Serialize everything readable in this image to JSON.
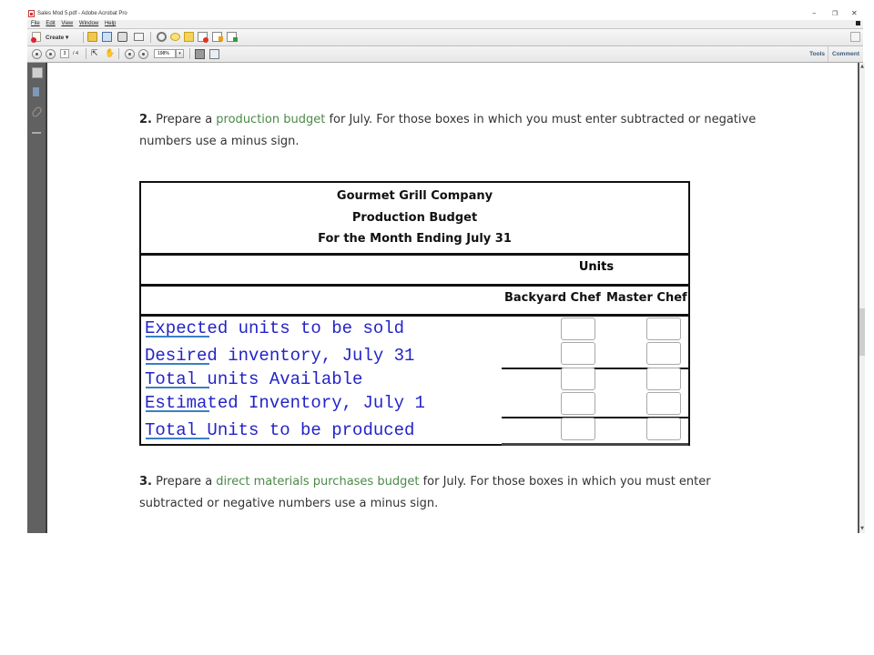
{
  "window": {
    "title": "Sales Mod 5.pdf - Adobe Acrobat Pro",
    "controls": {
      "minimize": "–",
      "restore": "❐",
      "close": "✕"
    }
  },
  "menu": [
    "File",
    "Edit",
    "View",
    "Window",
    "Help"
  ],
  "toolbar": {
    "create_label": "Create ▾",
    "icons": [
      "open-icon",
      "save-icon",
      "print-icon",
      "email-icon",
      "settings-icon",
      "comment-icon",
      "sticky-note-icon",
      "pdf-remove-icon",
      "pdf-export-icon",
      "pdf-share-icon"
    ],
    "expand_icon": "expand-icon"
  },
  "nav_toolbar": {
    "current_page": "3",
    "total_pages": "/ 4",
    "zoom": "198%",
    "zoom_dropdown": "▾",
    "tools_label": "Tools",
    "comment_label": "Comment"
  },
  "nav_pane": [
    "pages-icon",
    "bookmarks-icon",
    "attachments-icon",
    "signatures-icon"
  ],
  "question2": {
    "number": "2.",
    "prefix": " Prepare a ",
    "link": "production budget",
    "suffix": " for July. For those boxes in which you must enter subtracted or negative numbers use a minus sign."
  },
  "budget": {
    "company": "Gourmet Grill Company",
    "title": "Production Budget",
    "period": "For the Month Ending July 31",
    "units_label": "Units",
    "columns": [
      "Backyard Chef",
      "Master Chef"
    ],
    "rows": [
      {
        "label": "Expected units to be sold",
        "values": [
          "",
          ""
        ]
      },
      {
        "label": "Desired inventory, July 31",
        "values": [
          "",
          ""
        ]
      },
      {
        "label": "Total units Available",
        "values": [
          "",
          ""
        ]
      },
      {
        "label": "Estimated Inventory, July 1",
        "values": [
          "",
          ""
        ]
      },
      {
        "label": "Total Units to be produced",
        "values": [
          "",
          ""
        ]
      }
    ]
  },
  "question3": {
    "number": "3.",
    "prefix": " Prepare a ",
    "link": "direct materials purchases budget",
    "suffix": " for July. For those boxes in which you must enter subtracted or negative numbers use a minus sign."
  },
  "colors": {
    "accent_link": "#4b8a47",
    "handwriting": "#2323c8",
    "underline": "#3b7fc4"
  }
}
